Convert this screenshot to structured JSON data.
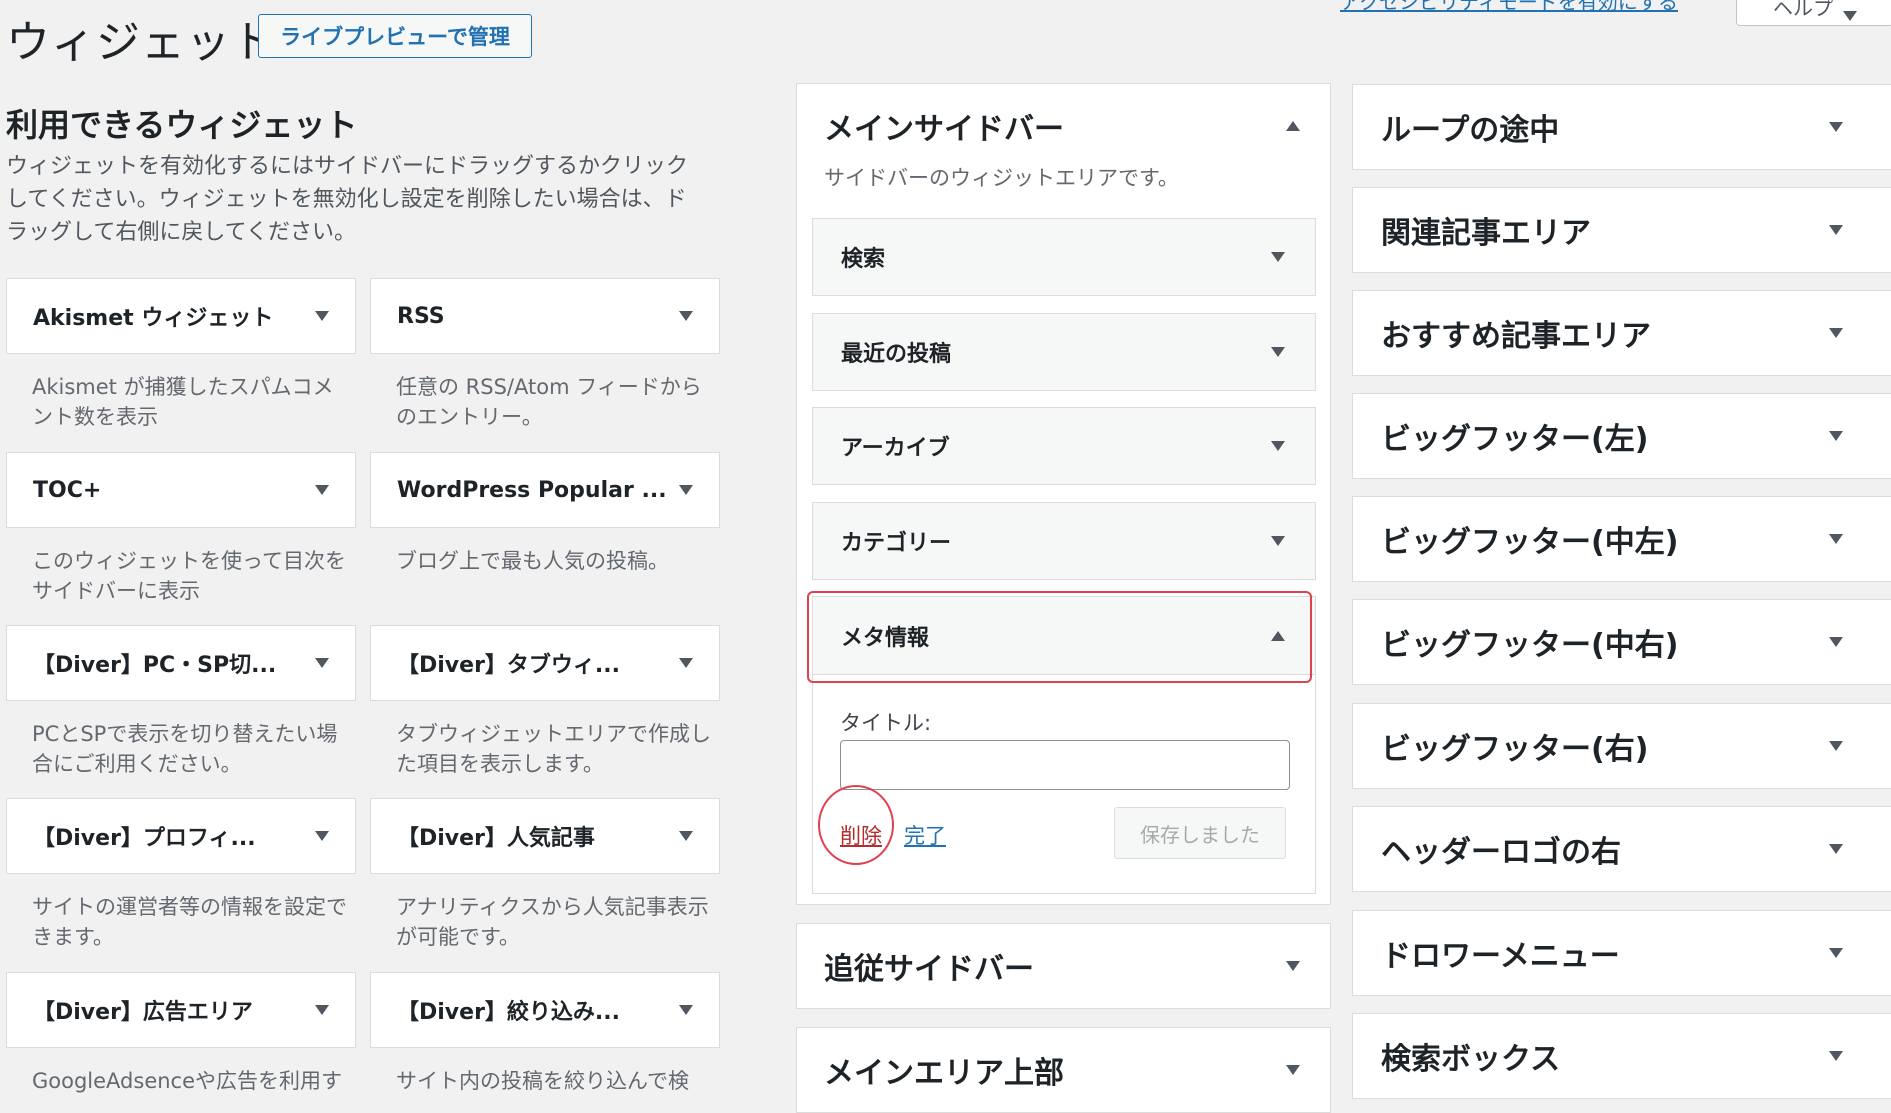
{
  "header": {
    "title": "ウィジェット",
    "live_preview_button": "ライブプレビューで管理",
    "accessibility_link": "アクセシビリティモードを有効にする",
    "help_button": "ヘルプ"
  },
  "available": {
    "title": "利用できるウィジェット",
    "description": "ウィジェットを有効化するにはサイドバーにドラッグするかクリックしてください。ウィジェットを無効化し設定を削除したい場合は、ドラッグして右側に戻してください。",
    "widgets": [
      {
        "name": "Akismet ウィジェット",
        "desc": "Akismet が捕獲したスパムコメント数を表示"
      },
      {
        "name": "RSS",
        "desc": "任意の RSS/Atom フィードからのエントリー。"
      },
      {
        "name": "TOC+",
        "desc": "このウィジェットを使って目次をサイドバーに表示"
      },
      {
        "name": "WordPress Popular ...",
        "desc": "ブログ上で最も人気の投稿。"
      },
      {
        "name": "【Diver】PC・SP切...",
        "desc": "PCとSPで表示を切り替えたい場合にご利用ください。"
      },
      {
        "name": "【Diver】タブウィ...",
        "desc": "タブウィジェットエリアで作成した項目を表示します。"
      },
      {
        "name": "【Diver】プロフィ...",
        "desc": "サイトの運営者等の情報を設定できます。"
      },
      {
        "name": "【Diver】人気記事",
        "desc": "アナリティクスから人気記事表示が可能です。"
      },
      {
        "name": "【Diver】広告エリア",
        "desc": "GoogleAdsenceや広告を利用す"
      },
      {
        "name": "【Diver】絞り込み...",
        "desc": "サイト内の投稿を絞り込んで検"
      }
    ]
  },
  "main_sidebar": {
    "title": "メインサイドバー",
    "description": "サイドバーのウィジットエリアです。",
    "widgets": [
      "検索",
      "最近の投稿",
      "アーカイブ",
      "カテゴリー",
      "メタ情報"
    ],
    "expanded": {
      "title_label": "タイトル:",
      "title_value": "",
      "delete_link": "削除",
      "done_link": "完了",
      "save_button": "保存しました"
    }
  },
  "other_sidebars": [
    "追従サイドバー",
    "メインエリア上部"
  ],
  "right_areas": [
    "ループの途中",
    "関連記事エリア",
    "おすすめ記事エリア",
    "ビッグフッター(左)",
    "ビッグフッター(中左)",
    "ビッグフッター(中右)",
    "ビッグフッター(右)",
    "ヘッダーロゴの右",
    "ドロワーメニュー",
    "検索ボックス"
  ],
  "colors": {
    "link": "#2271b1",
    "delete": "#b32d2e",
    "highlight": "#e0424d"
  }
}
